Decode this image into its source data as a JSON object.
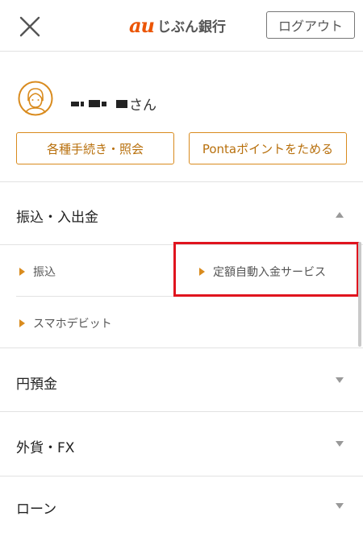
{
  "header": {
    "logo_mark": "au",
    "logo_text": "じぶん銀行",
    "logout_label": "ログアウト"
  },
  "profile": {
    "name_suffix": "さん",
    "buttons": {
      "procedures": "各種手続き・照会",
      "ponta": "Pontaポイントをためる"
    }
  },
  "menu": {
    "transfer_section": {
      "title": "振込・入出金",
      "items": [
        "振込",
        "定額自動入金サービス",
        "スマホデビット"
      ]
    },
    "sections": [
      "円預金",
      "外貨・FX",
      "ローン"
    ]
  },
  "colors": {
    "accent": "#d98b1e",
    "brand": "#eb5505",
    "highlight": "#e0141e"
  }
}
